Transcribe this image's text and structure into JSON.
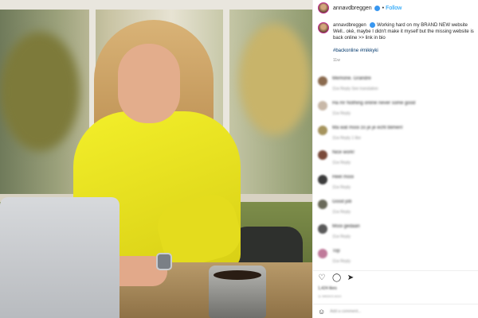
{
  "post": {
    "username": "annavdbreggen",
    "follow_label": "Follow",
    "dot": "•",
    "caption_line1": "Working hard on my BRAND NEW website",
    "caption_line2": "Well.. okè, maybe I didn't make it myself but the missing website is back online",
    "caption_line3": ">> link in bio",
    "hashtags": "#backonline #mikkyki",
    "posted_ago": "11w"
  },
  "comments": [
    {
      "user": "annavdbreggen",
      "text": "Memorie. Grandre",
      "meta": "11w   Reply   See translation",
      "avatar_color": "#8b6b4f"
    },
    {
      "user": "",
      "text": "Ha mr Nothing online never some good",
      "meta": "11w   Reply",
      "avatar_color": "#c8b8a8"
    },
    {
      "user": "",
      "text": "Ma wat mooi zo je je echt blimen!",
      "meta": "11w   Reply   1 like",
      "avatar_color": "#a6945e"
    },
    {
      "user": "",
      "text": "Nice work!",
      "meta": "11w   Reply",
      "avatar_color": "#7a4a3a"
    },
    {
      "user": "",
      "text": "Heel mooi",
      "meta": "11w   Reply",
      "avatar_color": "#3c3c3c"
    },
    {
      "user": "",
      "text": "Good job",
      "meta": "11w   Reply",
      "avatar_color": "#6a6a5a"
    },
    {
      "user": "",
      "text": "Mooi gedaan",
      "meta": "11w   Reply",
      "avatar_color": "#5a5a5a"
    },
    {
      "user": "",
      "text": "Top",
      "meta": "11w   Reply",
      "avatar_color": "#c07a9a"
    }
  ],
  "actions": {
    "like_icon": "heart-icon",
    "comment_icon": "comment-icon",
    "share_icon": "share-icon",
    "likes_text": "1,424 likes",
    "ago": "11 WEEKS AGO",
    "add_comment_placeholder": "Add a comment..."
  },
  "photo": {
    "logo_glyph": ""
  },
  "colors": {
    "follow": "#0095f6",
    "verified": "#3897f0",
    "hoodie": "#f3ef2a"
  }
}
